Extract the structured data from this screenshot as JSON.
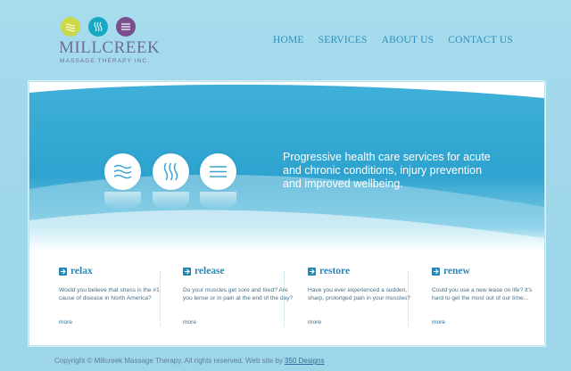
{
  "brand": {
    "name": "Millcreek",
    "tagline": "Massage Therapy Inc."
  },
  "nav": [
    "HOME",
    "SERVICES",
    "ABOUT US",
    "CONTACT US"
  ],
  "hero": {
    "text": "Progressive health care services for acute and chronic conditions, injury prevention and improved wellbeing."
  },
  "columns": [
    {
      "title": "relax",
      "body": "Would you believe that stress is the #1 cause of disease in North America?",
      "more": "more"
    },
    {
      "title": "release",
      "body": "Do your muscles get sore and tired? Are you tense or in pain at the end of the day?",
      "more": "more"
    },
    {
      "title": "restore",
      "body": "Have you ever experienced a sudden, sharp, prolonged pain in your muscles?",
      "more": "more"
    },
    {
      "title": "renew",
      "body": "Could you use a new lease on life? It's hard to get the most out of our time...",
      "more": "more"
    }
  ],
  "footer": {
    "copyright": "Copyright © Millcreek Massage Therapy. All rights reserved. Web site by ",
    "credit_link": "350 Designs"
  },
  "colors": {
    "accent": "#2d86b3",
    "hero_blue": "#2fa3cf",
    "logo_lime": "#cdd847",
    "logo_teal": "#16a9c5",
    "logo_purple": "#7a4f8e"
  },
  "icons": [
    "waves-horizontal-icon",
    "waves-vertical-icon",
    "lines-icon",
    "arrow-right-icon"
  ]
}
